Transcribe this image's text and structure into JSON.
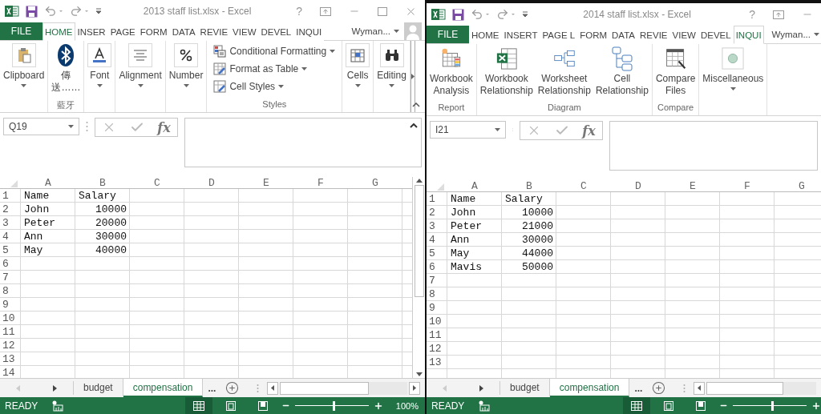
{
  "windows": [
    {
      "title": "2013 staff list.xlsx - Excel",
      "controls": [
        {
          "kind": "help",
          "label": "?"
        },
        {
          "kind": "ribbon-options"
        },
        {
          "kind": "minimize"
        },
        {
          "kind": "maximize"
        },
        {
          "kind": "close"
        }
      ],
      "file_tab": "FILE",
      "tabs": [
        {
          "label": "HOME",
          "selected": true
        },
        {
          "label": "INSER",
          "selected": false
        },
        {
          "label": "PAGE",
          "selected": false
        },
        {
          "label": "FORM",
          "selected": false
        },
        {
          "label": "DATA",
          "selected": false
        },
        {
          "label": "REVIE",
          "selected": false
        },
        {
          "label": "VIEW",
          "selected": false
        },
        {
          "label": "DEVEL",
          "selected": false
        },
        {
          "label": "INQUI",
          "selected": false
        }
      ],
      "account": "Wyman...",
      "avatar": true,
      "ribbon": {
        "scroll_right": true,
        "collapse": true,
        "groups": [
          {
            "items": [
              {
                "kind": "paste",
                "lines": [
                  "Clipboard"
                ],
                "dropdown": true
              }
            ]
          },
          {
            "label": "藍牙",
            "items": [
              {
                "kind": "bluetooth",
                "lines": [
                  "傳",
                  "送……"
                ],
                "dropdown": false
              }
            ]
          },
          {
            "items": [
              {
                "kind": "font",
                "lines": [
                  "Font"
                ],
                "dropdown": true
              }
            ]
          },
          {
            "items": [
              {
                "kind": "alignment",
                "lines": [
                  "Alignment"
                ],
                "dropdown": true
              }
            ]
          },
          {
            "items": [
              {
                "kind": "number",
                "lines": [
                  "Number"
                ],
                "dropdown": true
              }
            ]
          },
          {
            "label": "Styles",
            "stack": [
              {
                "kind": "conditional",
                "label": "Conditional Formatting",
                "dropdown": true
              },
              {
                "kind": "table",
                "label": "Format as Table",
                "dropdown": true
              },
              {
                "kind": "cellstyles",
                "label": "Cell Styles",
                "dropdown": true
              }
            ]
          },
          {
            "items": [
              {
                "kind": "cells",
                "lines": [
                  "Cells"
                ],
                "dropdown": true
              }
            ]
          },
          {
            "items": [
              {
                "kind": "editing",
                "lines": [
                  "Editing"
                ],
                "dropdown": true
              }
            ]
          }
        ]
      },
      "name_box": "Q19",
      "function_label": "fx",
      "formula_collapse": true,
      "grid": {
        "columns": [
          "A",
          "B",
          "C",
          "D",
          "E",
          "F",
          "G"
        ],
        "rows": [
          {
            "header": "1",
            "cells": [
              "Name",
              "Salary"
            ]
          },
          {
            "header": "2",
            "cells": [
              "John",
              "10000"
            ]
          },
          {
            "header": "3",
            "cells": [
              "Peter",
              "20000"
            ]
          },
          {
            "header": "4",
            "cells": [
              "Ann",
              "30000"
            ]
          },
          {
            "header": "5",
            "cells": [
              "May",
              "40000"
            ]
          },
          {
            "header": "6",
            "cells": []
          },
          {
            "header": "7",
            "cells": []
          },
          {
            "header": "8",
            "cells": []
          },
          {
            "header": "9",
            "cells": []
          },
          {
            "header": "10",
            "cells": []
          },
          {
            "header": "11",
            "cells": []
          },
          {
            "header": "12",
            "cells": []
          },
          {
            "header": "13",
            "cells": []
          },
          {
            "header": "14",
            "cells": []
          }
        ]
      },
      "scrollbars": true,
      "sheets": [
        {
          "label": "budget",
          "selected": false
        },
        {
          "label": "compensation",
          "selected": true
        }
      ],
      "more_sheets": "...",
      "status": {
        "text": "READY",
        "level": 0.55,
        "zoom": "100%"
      }
    },
    {
      "title": "2014 staff list.xlsx - Excel",
      "controls": [
        {
          "kind": "help",
          "label": "?"
        },
        {
          "kind": "ribbon-options"
        },
        {
          "kind": "minimize"
        }
      ],
      "file_tab": "FILE",
      "tabs": [
        {
          "label": "HOME",
          "selected": false
        },
        {
          "label": "INSERT",
          "selected": false
        },
        {
          "label": "PAGE L",
          "selected": false
        },
        {
          "label": "FORM",
          "selected": false
        },
        {
          "label": "DATA",
          "selected": false
        },
        {
          "label": "REVIE",
          "selected": false
        },
        {
          "label": "VIEW",
          "selected": false
        },
        {
          "label": "DEVEL",
          "selected": false
        },
        {
          "label": "INQUI",
          "selected": true
        }
      ],
      "account": "Wyman...",
      "avatar": false,
      "ribbon": {
        "scroll_right": false,
        "collapse": false,
        "groups": [
          {
            "label": "Report",
            "items": [
              {
                "kind": "analysis",
                "lines": [
                  "Workbook",
                  "Analysis"
                ],
                "dropdown": false
              }
            ]
          },
          {
            "label": "Diagram",
            "items": [
              {
                "kind": "workbook",
                "lines": [
                  "Workbook",
                  "Relationship"
                ],
                "dropdown": false
              },
              {
                "kind": "worksheet",
                "lines": [
                  "Worksheet",
                  "Relationship"
                ],
                "dropdown": false
              },
              {
                "kind": "cell",
                "lines": [
                  "Cell",
                  "Relationship"
                ],
                "dropdown": false
              }
            ]
          },
          {
            "label": "Compare",
            "items": [
              {
                "kind": "compare",
                "lines": [
                  "Compare",
                  "Files"
                ],
                "dropdown": false
              }
            ]
          },
          {
            "items": [
              {
                "kind": "misc",
                "lines": [
                  "Miscellaneous"
                ],
                "dropdown": true
              }
            ]
          }
        ]
      },
      "name_box": "I21",
      "function_label": "fx",
      "formula_collapse": false,
      "grid": {
        "columns": [
          "A",
          "B",
          "C",
          "D",
          "E",
          "F",
          "G"
        ],
        "rows": [
          {
            "header": "1",
            "cells": [
              "Name",
              "Salary"
            ]
          },
          {
            "header": "2",
            "cells": [
              "John",
              "10000"
            ]
          },
          {
            "header": "3",
            "cells": [
              "Peter",
              "21000"
            ]
          },
          {
            "header": "4",
            "cells": [
              "Ann",
              "30000"
            ]
          },
          {
            "header": "5",
            "cells": [
              "May",
              "44000"
            ]
          },
          {
            "header": "6",
            "cells": [
              "Mavis",
              "50000"
            ]
          },
          {
            "header": "7",
            "cells": []
          },
          {
            "header": "8",
            "cells": []
          },
          {
            "header": "9",
            "cells": []
          },
          {
            "header": "10",
            "cells": []
          },
          {
            "header": "11",
            "cells": []
          },
          {
            "header": "12",
            "cells": []
          },
          {
            "header": "13",
            "cells": []
          }
        ]
      },
      "scrollbars": false,
      "sheets": [
        {
          "label": "budget",
          "selected": false
        },
        {
          "label": "compensation",
          "selected": true
        }
      ],
      "more_sheets": "...",
      "status": {
        "text": "READY",
        "level": 0.55
      }
    }
  ]
}
